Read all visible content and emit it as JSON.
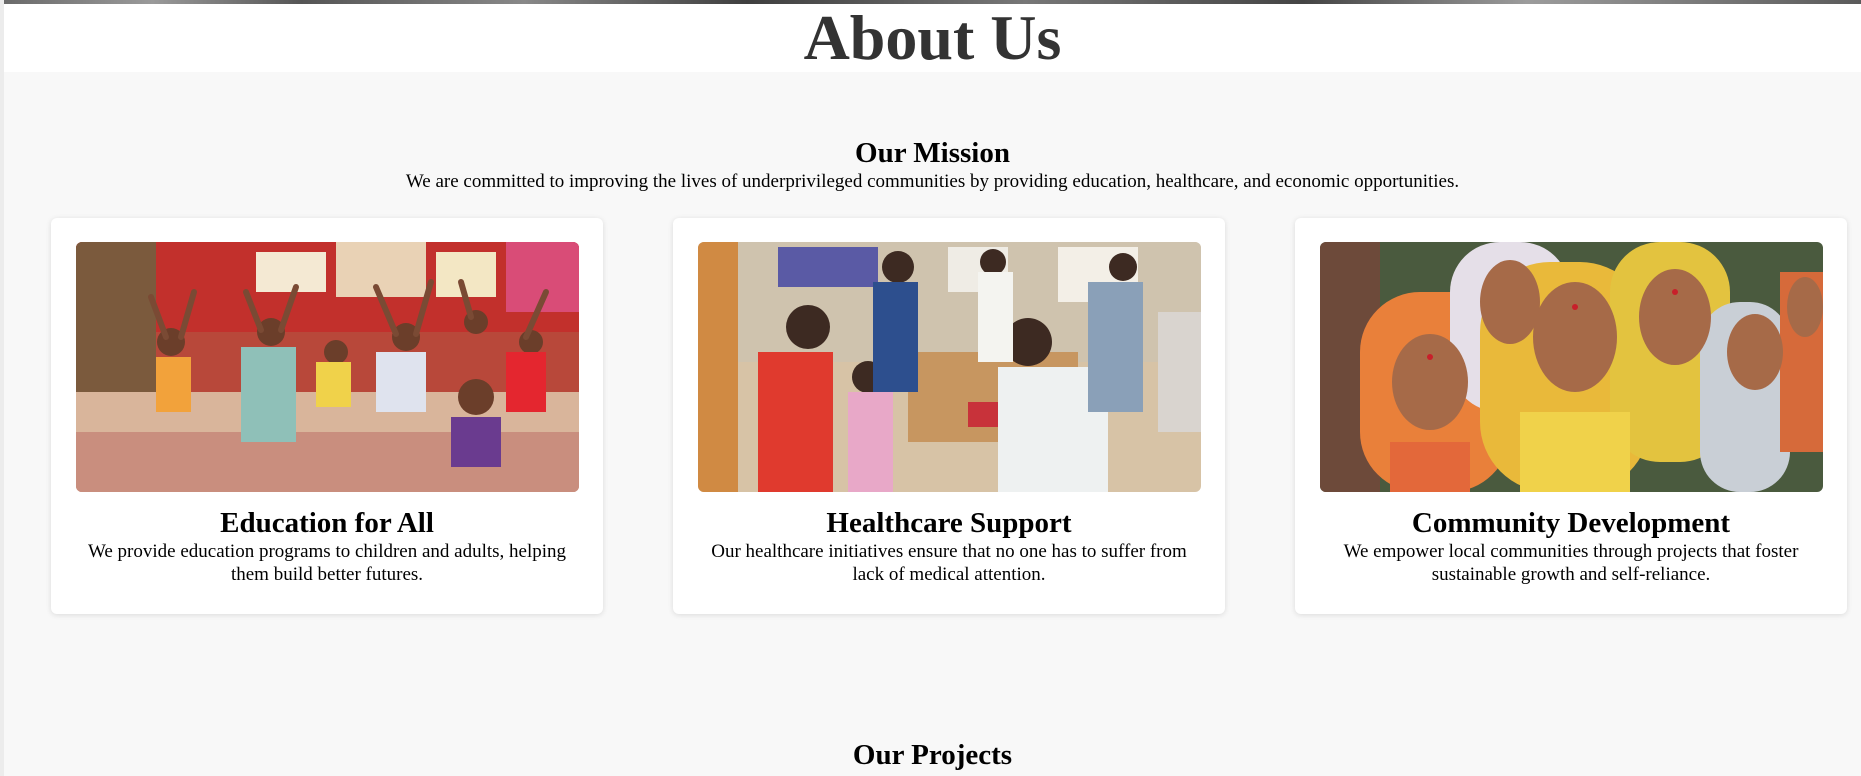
{
  "header": {
    "title": "About Us"
  },
  "mission": {
    "title": "Our Mission",
    "text": "We are committed to improving the lives of underprivileged communities by providing education, healthcare, and economic opportunities."
  },
  "cards": [
    {
      "title": "Education for All",
      "text": "We provide education programs to children and adults, helping them build better futures.",
      "image_alt": "Children in a classroom raising their hands"
    },
    {
      "title": "Healthcare Support",
      "text": "Our healthcare initiatives ensure that no one has to suffer from lack of medical attention.",
      "image_alt": "Doctor examining a child at a community clinic"
    },
    {
      "title": "Community Development",
      "text": "We empower local communities through projects that foster sustainable growth and self-reliance.",
      "image_alt": "Smiling women wearing colorful saris"
    }
  ],
  "projects": {
    "title": "Our Projects"
  }
}
